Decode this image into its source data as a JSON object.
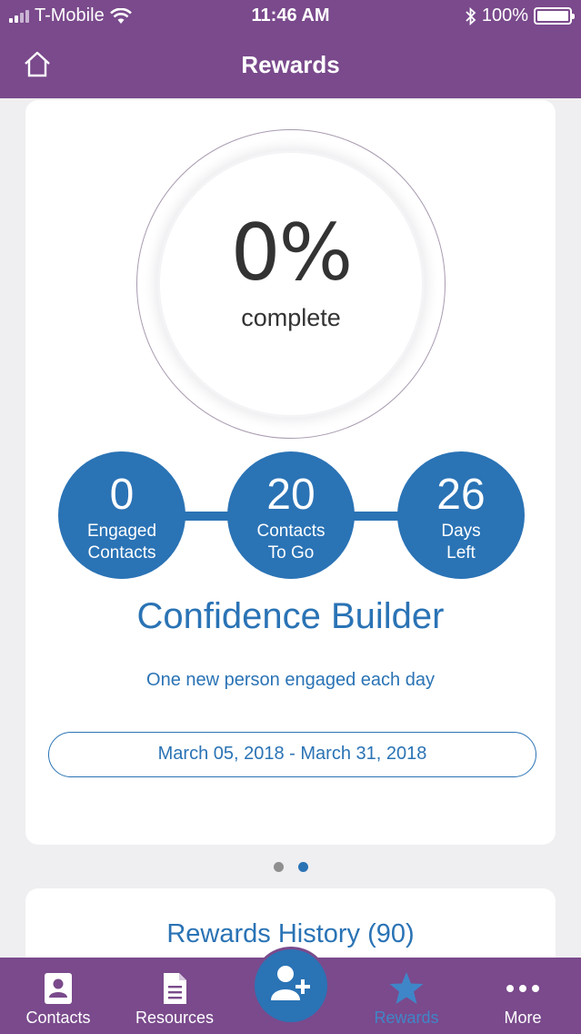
{
  "status_bar": {
    "carrier": "T-Mobile",
    "time": "11:46 AM",
    "battery": "100%"
  },
  "header": {
    "title": "Rewards"
  },
  "progress": {
    "percent": "0%",
    "label": "complete"
  },
  "stats": [
    {
      "value": "0",
      "label_line1": "Engaged",
      "label_line2": "Contacts"
    },
    {
      "value": "20",
      "label_line1": "Contacts",
      "label_line2": "To Go"
    },
    {
      "value": "26",
      "label_line1": "Days",
      "label_line2": "Left"
    }
  ],
  "goal": {
    "title": "Confidence Builder",
    "subtitle": "One new person engaged each day",
    "date_range": "March 05, 2018 - March 31, 2018"
  },
  "pager": {
    "pages": 2,
    "active_index": 1
  },
  "history": {
    "title": "Rewards History (90)"
  },
  "tabs": [
    {
      "label": "Contacts",
      "icon": "contacts-icon"
    },
    {
      "label": "Resources",
      "icon": "document-icon"
    },
    {
      "label": "Rewards",
      "icon": "star-icon",
      "active": true
    },
    {
      "label": "More",
      "icon": "more-icon"
    }
  ],
  "fab": {
    "icon": "add-contact-icon"
  },
  "colors": {
    "brand_purple": "#7a4a8c",
    "accent_blue": "#2a73b5",
    "active_tab": "#3f86c8"
  }
}
